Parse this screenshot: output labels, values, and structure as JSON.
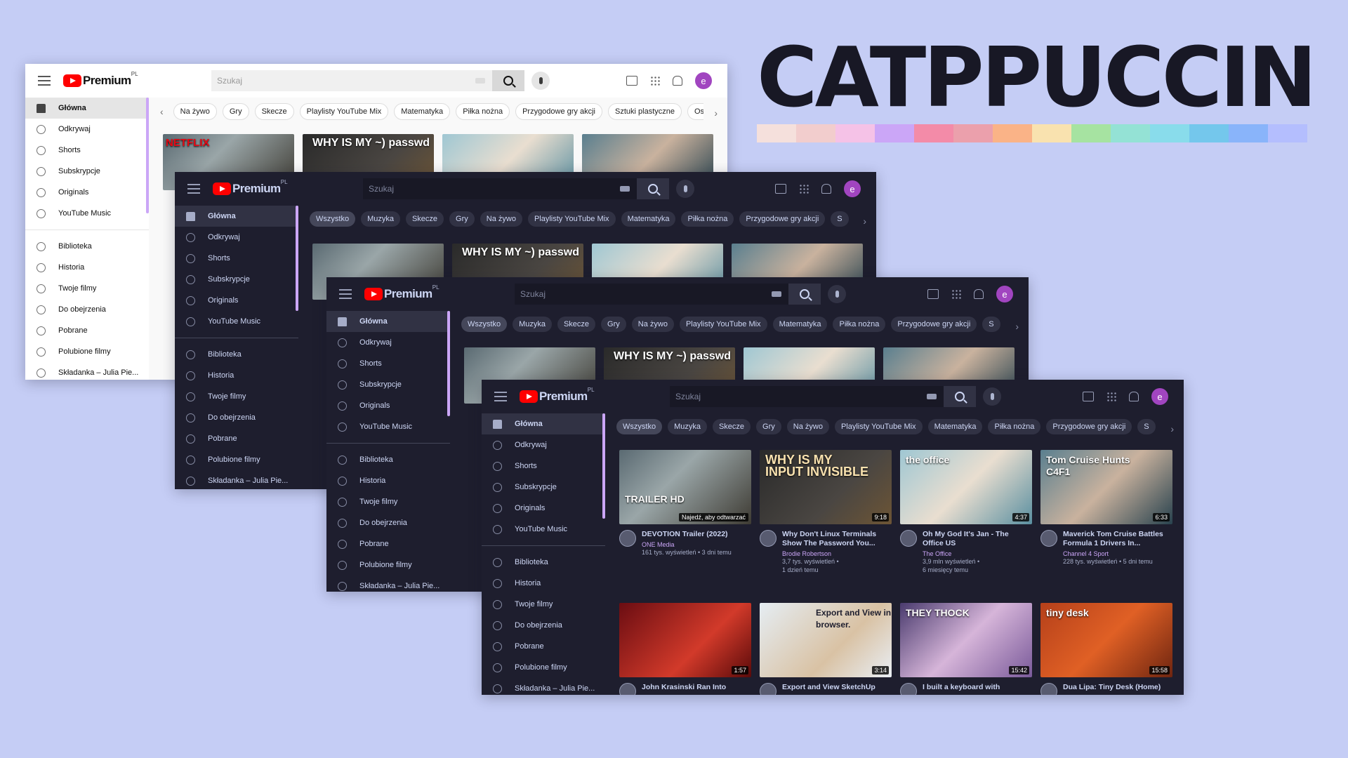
{
  "brand": {
    "title": "CATPPUCCIN",
    "palette": [
      "#f5e0dc",
      "#f2cdcd",
      "#f5c2e7",
      "#cba6f7",
      "#f38ba8",
      "#eba0ac",
      "#fab387",
      "#f9e2af",
      "#a6e3a1",
      "#94e2d5",
      "#89dceb",
      "#74c7ec",
      "#89b4fa",
      "#b4befe"
    ]
  },
  "youtube": {
    "logo_text": "Premium",
    "logo_region": "PL",
    "search_placeholder": "Szukaj",
    "avatar_letter": "e",
    "hover_tooltip": "Najedź, aby odtwarzać",
    "sidebar": {
      "main": [
        "Główna",
        "Odkrywaj",
        "Shorts",
        "Subskrypcje",
        "Originals",
        "YouTube Music"
      ],
      "library": [
        "Biblioteka",
        "Historia",
        "Twoje filmy",
        "Do obejrzenia",
        "Pobrane",
        "Polubione filmy",
        "Składanka – Julia Pie..."
      ]
    },
    "chips_dark": [
      "Wszystko",
      "Muzyka",
      "Skecze",
      "Gry",
      "Na żywo",
      "Playlisty YouTube Mix",
      "Matematyka",
      "Piłka nożna",
      "Przygodowe gry akcji",
      "S"
    ],
    "chips_light": [
      "Na żywo",
      "Gry",
      "Skecze",
      "Playlisty YouTube Mix",
      "Matematyka",
      "Piłka nożna",
      "Przygodowe gry akcji",
      "Sztuki plastyczne",
      "Os"
    ],
    "videos": [
      {
        "title": "DEVOTION Trailer (2022)",
        "channel": "ONE Media",
        "stats": [
          "161 tys. wyświetleń • 3 dni temu"
        ],
        "duration": "",
        "thumb_text": "TRAILER HD"
      },
      {
        "title": "Why Don't Linux Terminals Show The Password You...",
        "channel": "Brodie Robertson",
        "stats": [
          "3,7 tys. wyświetleń •",
          "1 dzień temu"
        ],
        "duration": "9:18",
        "thumb_text": "WHY IS MY INPUT INVISIBLE"
      },
      {
        "title": "Oh My God It's Jan - The Office US",
        "channel": "The Office",
        "stats": [
          "3,9 mln wyświetleń •",
          "6 miesięcy temu"
        ],
        "duration": "4:37",
        "thumb_text": "the office"
      },
      {
        "title": "Maverick Tom Cruise Battles Formula 1 Drivers In...",
        "channel": "Channel 4 Sport",
        "stats": [
          "228 tys. wyświetleń • 5 dni temu"
        ],
        "duration": "6:33",
        "thumb_text": "Tom Cruise Hunts C4F1"
      },
      {
        "title": "John Krasinski Ran Into",
        "channel": "",
        "stats": [],
        "duration": "1:57",
        "thumb_text": ""
      },
      {
        "title": "Export and View SketchUp",
        "channel": "",
        "stats": [],
        "duration": "3:14",
        "thumb_text": "Export and View in browser."
      },
      {
        "title": "I built a keyboard with",
        "channel": "",
        "stats": [],
        "duration": "15:42",
        "thumb_text": "THEY THOCK"
      },
      {
        "title": "Dua Lipa: Tiny Desk (Home)",
        "channel": "",
        "stats": [],
        "duration": "15:58",
        "thumb_text": "tiny desk"
      }
    ],
    "thumb_small_text": [
      "WHY IS MY ~) passwd"
    ],
    "netflix_text": "NETFLIX"
  },
  "colors": {
    "bg": "#c5cdf5",
    "accent": "#cba6f7",
    "dark_base": "#1e1e2e"
  }
}
